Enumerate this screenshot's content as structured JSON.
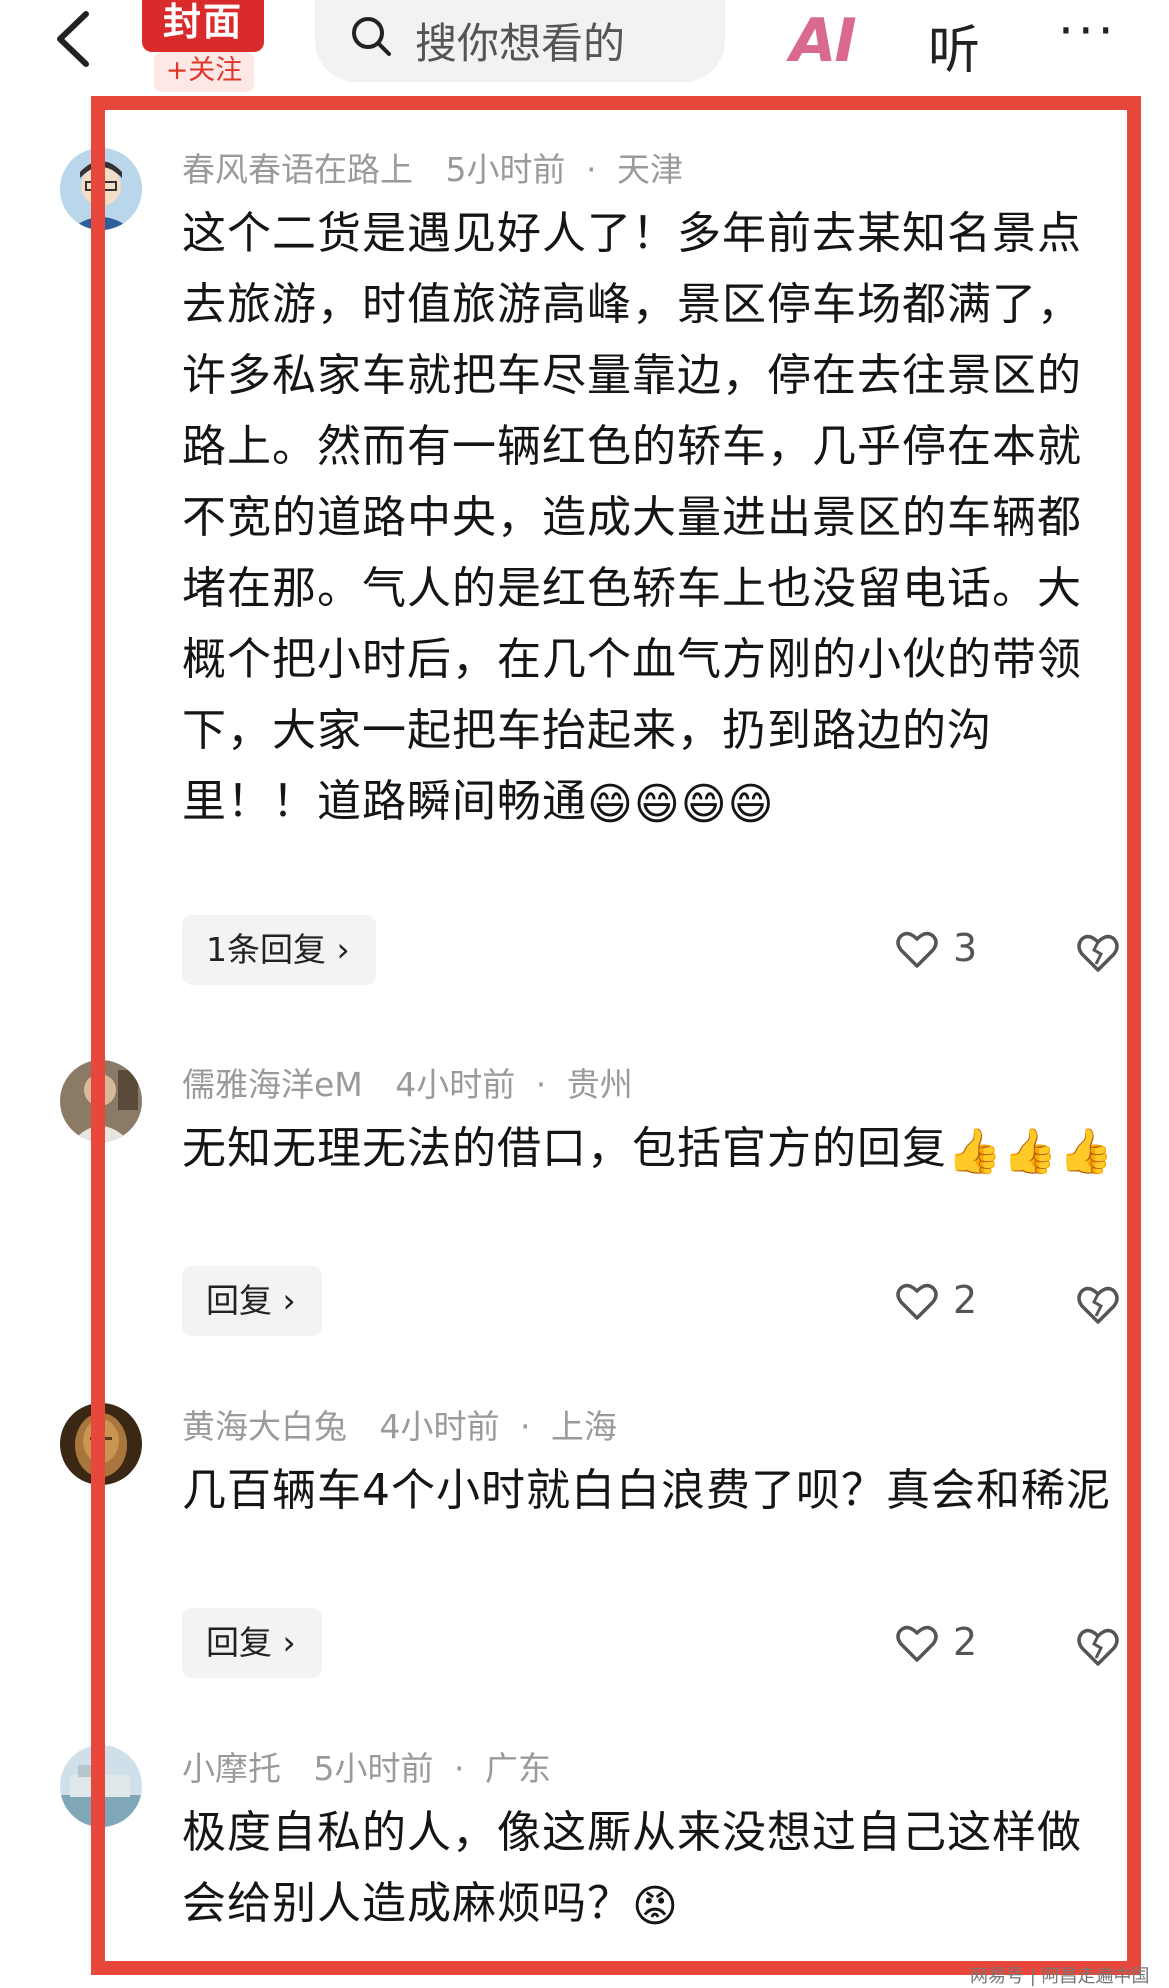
{
  "header": {
    "logo_text": "封面",
    "follow_label": "+关注",
    "search_placeholder": "搜你想看的",
    "ai_label": "AI",
    "listen_label": "听",
    "more_label": "···"
  },
  "comments": [
    {
      "username": "春风春语在路上",
      "time": "5小时前",
      "location": "天津",
      "text": "这个二货是遇见好人了！多年前去某知名景点去旅游，时值旅游高峰，景区停车场都满了，许多私家车就把车尽量靠边，停在去往景区的路上。然而有一辆红色的轿车，几乎停在本就不宽的道路中央，造成大量进出景区的车辆都堵在那。气人的是红色轿车上也没留电话。大概个把小时后，在几个血气方刚的小伙的带领下，大家一起把车抬起来，扔到路边的沟里！！道路瞬间畅通",
      "emojis": "😄😄😄😄",
      "reply_label": "1条回复 ›",
      "likes": "3"
    },
    {
      "username": "儒雅海洋eM",
      "time": "4小时前",
      "location": "贵州",
      "text": "无知无理无法的借口，包括官方的回复",
      "emojis": "👍👍👍",
      "reply_label": "回复 ›",
      "likes": "2"
    },
    {
      "username": "黄海大白兔",
      "time": "4小时前",
      "location": "上海",
      "text": "几百辆车4个小时就白白浪费了呗？真会和稀泥",
      "emojis": "",
      "reply_label": "回复 ›",
      "likes": "2"
    },
    {
      "username": "小摩托",
      "time": "5小时前",
      "location": "广东",
      "text": "极度自私的人，像这厮从来没想过自己这样做会给别人造成麻烦吗？",
      "emojis": "😡",
      "reply_label": "",
      "likes": ""
    }
  ],
  "watermark": "网易号 | 阿昌走遍中国",
  "colors": {
    "accent_red": "#e8473b",
    "logo_red": "#d92b2b"
  }
}
